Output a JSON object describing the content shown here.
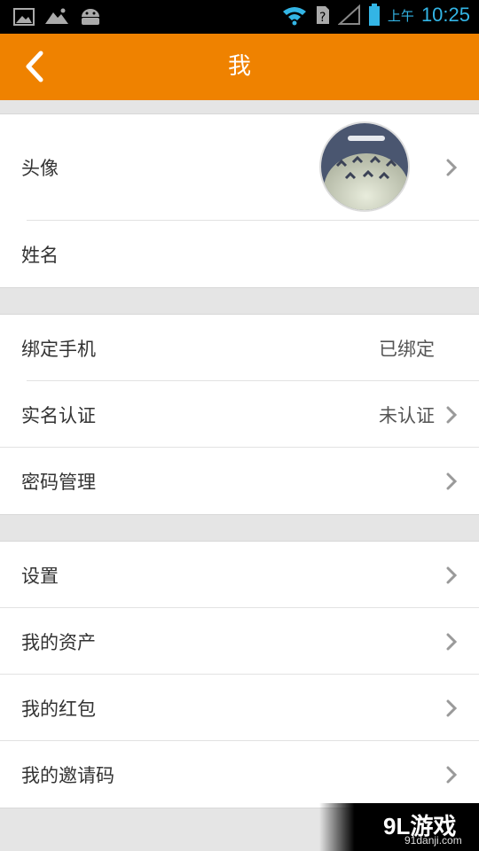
{
  "status_bar": {
    "time": "10:25",
    "ampm": "上午",
    "left_icons": [
      "gallery-icon",
      "mountain-image-icon",
      "android-icon"
    ],
    "right_icons": [
      "wifi-icon",
      "unknown-sim-icon",
      "signal-icon",
      "battery-icon"
    ],
    "accent_color": "#33b5e5"
  },
  "header": {
    "title": "我",
    "back_icon": "chevron-left-icon",
    "background": "#ef8200"
  },
  "profile_group": {
    "avatar_label": "头像",
    "name_label": "姓名",
    "name_value": ""
  },
  "account_group": {
    "items": [
      {
        "label": "绑定手机",
        "value": "已绑定",
        "chevron": false
      },
      {
        "label": "实名认证",
        "value": "未认证",
        "chevron": true
      },
      {
        "label": "密码管理",
        "value": "",
        "chevron": true
      }
    ]
  },
  "more_group": {
    "items": [
      {
        "label": "设置",
        "chevron": true
      },
      {
        "label": "我的资产",
        "chevron": true
      },
      {
        "label": "我的红包",
        "chevron": true
      },
      {
        "label": "我的邀请码",
        "chevron": true
      }
    ]
  },
  "watermark": {
    "logo": "9L游戏",
    "url": "91danji.com"
  }
}
